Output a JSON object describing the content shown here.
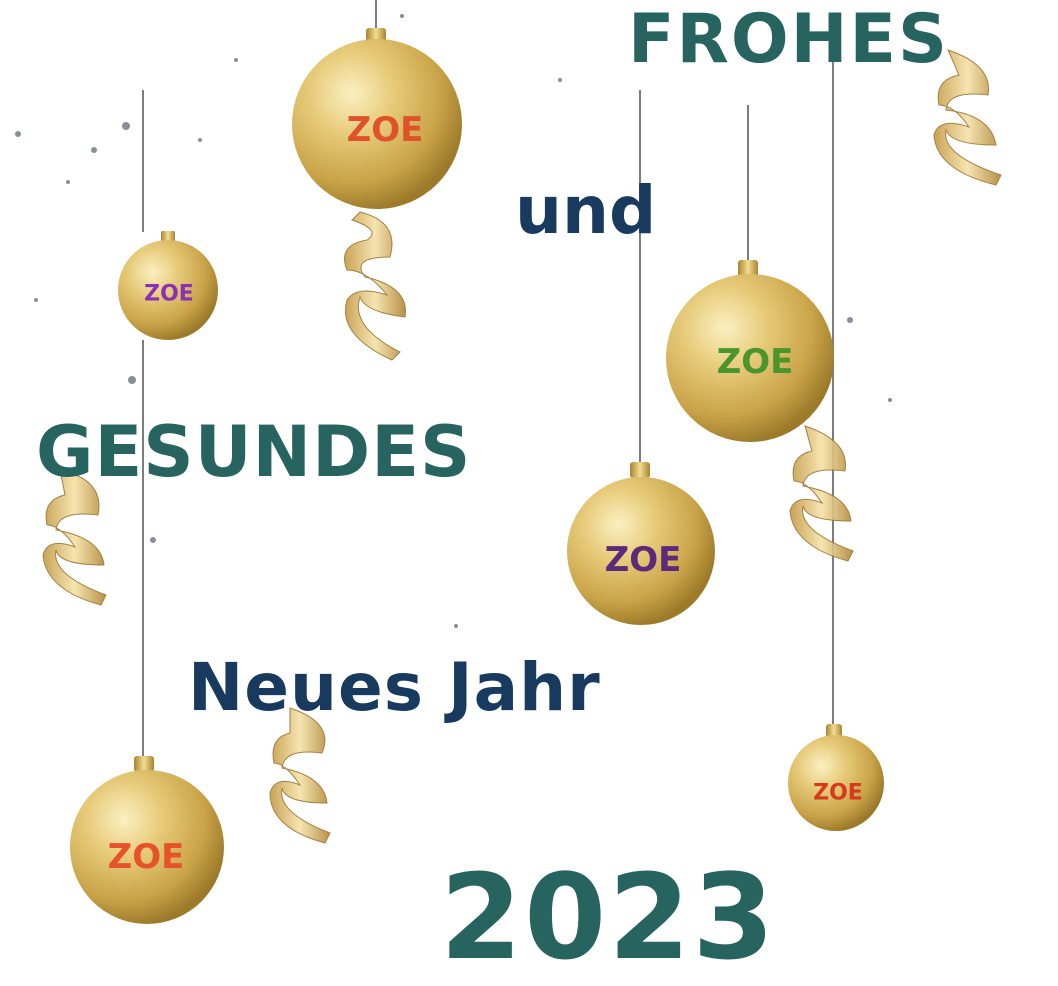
{
  "colors": {
    "teal": "#276460",
    "navy": "#183a5e",
    "gold_light": "#f8e8a6",
    "gold_mid": "#d9b65a",
    "gold_dark": "#9c7a2a"
  },
  "greeting": {
    "line1": "FROHES",
    "line2": "und",
    "line3": "GESUNDES",
    "line4": "Neues Jahr",
    "year": "2023"
  },
  "ornaments": [
    {
      "label": "ZOE",
      "label_color": "#e0532a",
      "icon": "christmas-bauble-icon"
    },
    {
      "label": "ZOE",
      "label_color": "#8b2fb8",
      "icon": "christmas-bauble-icon"
    },
    {
      "label": "ZOE",
      "label_color": "#4a962c",
      "icon": "christmas-bauble-icon"
    },
    {
      "label": "ZOE",
      "label_color": "#5b2a7a",
      "icon": "christmas-bauble-icon"
    },
    {
      "label": "ZOE",
      "label_color": "#e8522a",
      "icon": "christmas-bauble-icon"
    },
    {
      "label": "ZOE",
      "label_color": "#d6391e",
      "icon": "christmas-bauble-icon"
    }
  ]
}
